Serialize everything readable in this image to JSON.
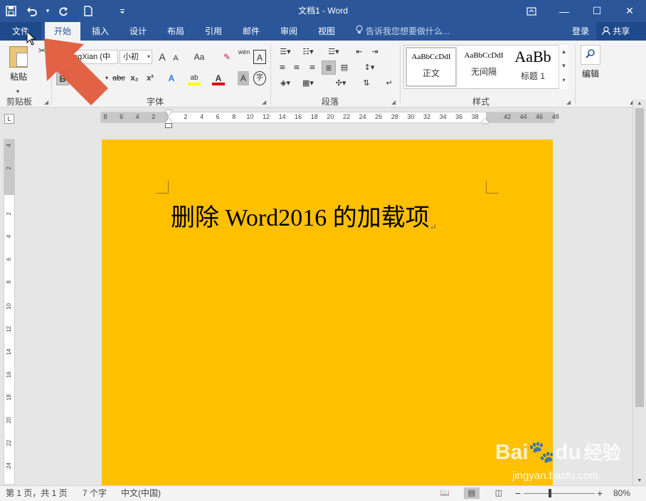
{
  "title_bar": {
    "doc_title": "文档1 - Word",
    "qat": {
      "save_icon": "save-icon",
      "undo_icon": "undo-icon",
      "redo_icon": "redo-icon",
      "new_icon": "new-doc-icon",
      "customize_icon": "customize-qat-icon"
    },
    "window": {
      "ribbon_display_icon": "ribbon-display-options-icon",
      "minimize": "—",
      "maximize": "☐",
      "close": "✕"
    }
  },
  "tabs": [
    {
      "label": "文件"
    },
    {
      "label": "开始"
    },
    {
      "label": "插入"
    },
    {
      "label": "设计"
    },
    {
      "label": "布局"
    },
    {
      "label": "引用"
    },
    {
      "label": "邮件"
    },
    {
      "label": "审阅"
    },
    {
      "label": "视图"
    }
  ],
  "tell_me": {
    "placeholder": "告诉我您想要做什么..."
  },
  "account": {
    "signin": "登录",
    "share": "共享"
  },
  "ribbon": {
    "clipboard": {
      "paste": "粘贴",
      "group_label": "剪贴板"
    },
    "font": {
      "font_name": "ngXian (中",
      "font_size": "小初",
      "group_label": "字体",
      "grow": "A",
      "shrink": "A",
      "change_case": "Aa",
      "phonetic": "wén",
      "bold": "B",
      "strike": "abc",
      "subscript": "x₂",
      "superscript": "x²",
      "text_effects": "A",
      "font_color": "A",
      "char_shading": "A",
      "enclose": "字"
    },
    "paragraph": {
      "group_label": "段落"
    },
    "styles": {
      "group_label": "样式",
      "items": [
        {
          "sample": "AaBbCcDdI",
          "name": "正文"
        },
        {
          "sample": "AaBbCcDdI",
          "name": "无间隔"
        },
        {
          "sample": "AaBb",
          "name": "标题 1"
        }
      ]
    },
    "editing": {
      "label": "编辑"
    }
  },
  "ruler": {
    "corner": "L",
    "h_numbers": [
      "8",
      "6",
      "4",
      "2",
      "",
      "2",
      "4",
      "6",
      "8",
      "10",
      "12",
      "14",
      "16",
      "18",
      "20",
      "22",
      "24",
      "26",
      "28",
      "30",
      "32",
      "34",
      "36",
      "38",
      "",
      "42",
      "44",
      "46",
      "48"
    ],
    "v_numbers": [
      "4",
      "2",
      "",
      "2",
      "4",
      "6",
      "8",
      "10",
      "12",
      "14",
      "16",
      "18",
      "20",
      "22",
      "24"
    ]
  },
  "document": {
    "page_color": "#ffc000",
    "heading": "删除 Word2016 的加载项",
    "para_mark": "↵"
  },
  "status_bar": {
    "page": "第 1 页，共 1 页",
    "words": "7 个字",
    "language": "中文(中国)",
    "zoom": "80%",
    "zoom_minus": "−",
    "zoom_plus": "+"
  },
  "watermark": {
    "logo_text": "Bai",
    "logo_suffix": "du",
    "logo_cn": "经验",
    "url": "jingyan.baidu.com"
  },
  "colors": {
    "accent": "#2b579a",
    "annotation_arrow": "#e05a3c",
    "page": "#ffc000"
  }
}
